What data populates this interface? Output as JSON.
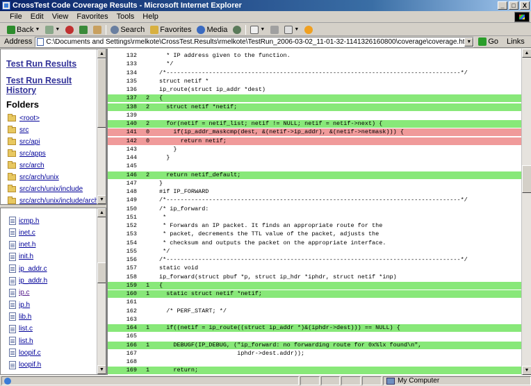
{
  "window": {
    "title": "CrossTest Code Coverage Results - Microsoft Internet Explorer",
    "controls": [
      "_",
      "□",
      "X"
    ]
  },
  "menu": [
    "File",
    "Edit",
    "View",
    "Favorites",
    "Tools",
    "Help"
  ],
  "toolbar": {
    "back": "Back",
    "search": "Search",
    "favorites": "Favorites",
    "media": "Media"
  },
  "address": {
    "label": "Address",
    "value": "C:\\Documents and Settings\\rmelkote\\CrossTest.Results\\rmelkote\\TestRun_2006-03-02_11-01-32-1141326160800\\coverage\\coverage.html",
    "go": "Go",
    "links": "Links"
  },
  "nav": {
    "test_run_results": "Test Run Results",
    "test_run_result_history": [
      "Test Run Result",
      "History"
    ],
    "folders_heading": "Folders",
    "folders": [
      "<root>",
      "src",
      "src/api",
      "src/apps",
      "src/arch",
      "src/arch/unix",
      "src/arch/unix/include",
      "src/arch/unix/include/arch"
    ],
    "files": [
      "icmp.h",
      "inet.c",
      "inet.h",
      "init.h",
      "ip_addr.c",
      "ip_addr.h",
      "ip.c",
      "ip.h",
      "lib.h",
      "list.c",
      "list.h",
      "loopif.c",
      "loopif.h"
    ]
  },
  "status": {
    "zone": "My Computer"
  },
  "code": [
    {
      "n": "132",
      "c": "",
      "s": "  * IP address given to the function.",
      "h": ""
    },
    {
      "n": "133",
      "c": "",
      "s": "  */",
      "h": ""
    },
    {
      "n": "134",
      "c": "",
      "s": "/*-----------------------------------------------------------------------------------*/",
      "h": ""
    },
    {
      "n": "135",
      "c": "",
      "s": "struct netif *",
      "h": ""
    },
    {
      "n": "136",
      "c": "",
      "s": "ip_route(struct ip_addr *dest)",
      "h": ""
    },
    {
      "n": "137",
      "c": "2",
      "s": "{",
      "h": "g"
    },
    {
      "n": "138",
      "c": "2",
      "s": "  struct netif *netif;",
      "h": "g"
    },
    {
      "n": "139",
      "c": "",
      "s": "",
      "h": ""
    },
    {
      "n": "140",
      "c": "2",
      "s": "  for(netif = netif_list; netif != NULL; netif = netif->next) {",
      "h": "g"
    },
    {
      "n": "141",
      "c": "0",
      "s": "    if(ip_addr_maskcmp(dest, &(netif->ip_addr), &(netif->netmask))) {",
      "h": "r"
    },
    {
      "n": "142",
      "c": "0",
      "s": "      return netif;",
      "h": "r"
    },
    {
      "n": "143",
      "c": "",
      "s": "    }",
      "h": ""
    },
    {
      "n": "144",
      "c": "",
      "s": "  }",
      "h": ""
    },
    {
      "n": "145",
      "c": "",
      "s": "",
      "h": ""
    },
    {
      "n": "146",
      "c": "2",
      "s": "  return netif_default;",
      "h": "g"
    },
    {
      "n": "147",
      "c": "",
      "s": "}",
      "h": ""
    },
    {
      "n": "148",
      "c": "",
      "s": "#if IP_FORWARD",
      "h": ""
    },
    {
      "n": "149",
      "c": "",
      "s": "/*-----------------------------------------------------------------------------------*/",
      "h": ""
    },
    {
      "n": "150",
      "c": "",
      "s": "/* ip_forward:",
      "h": ""
    },
    {
      "n": "151",
      "c": "",
      "s": " *",
      "h": ""
    },
    {
      "n": "152",
      "c": "",
      "s": " * Forwards an IP packet. It finds an appropriate route for the",
      "h": ""
    },
    {
      "n": "153",
      "c": "",
      "s": " * packet, decrements the TTL value of the packet, adjusts the",
      "h": ""
    },
    {
      "n": "154",
      "c": "",
      "s": " * checksum and outputs the packet on the appropriate interface.",
      "h": ""
    },
    {
      "n": "155",
      "c": "",
      "s": " */",
      "h": ""
    },
    {
      "n": "156",
      "c": "",
      "s": "/*-----------------------------------------------------------------------------------*/",
      "h": ""
    },
    {
      "n": "157",
      "c": "",
      "s": "static void",
      "h": ""
    },
    {
      "n": "158",
      "c": "",
      "s": "ip_forward(struct pbuf *p, struct ip_hdr *iphdr, struct netif *inp)",
      "h": ""
    },
    {
      "n": "159",
      "c": "1",
      "s": "{",
      "h": "g"
    },
    {
      "n": "160",
      "c": "1",
      "s": "  static struct netif *netif;",
      "h": "g"
    },
    {
      "n": "161",
      "c": "",
      "s": "",
      "h": ""
    },
    {
      "n": "162",
      "c": "",
      "s": "  /* PERF_START; */",
      "h": ""
    },
    {
      "n": "163",
      "c": "",
      "s": "",
      "h": ""
    },
    {
      "n": "164",
      "c": "1",
      "s": "  if((netif = ip_route((struct ip_addr *)&(iphdr->dest))) == NULL) {",
      "h": "g"
    },
    {
      "n": "165",
      "c": "",
      "s": "",
      "h": ""
    },
    {
      "n": "166",
      "c": "1",
      "s": "    DEBUGF(IP_DEBUG, (\"ip_forward: no forwarding route for 0x%lx found\\n\",",
      "h": "g"
    },
    {
      "n": "167",
      "c": "",
      "s": "                      iphdr->dest.addr));",
      "h": ""
    },
    {
      "n": "168",
      "c": "",
      "s": "",
      "h": ""
    },
    {
      "n": "169",
      "c": "1",
      "s": "    return;",
      "h": "g"
    }
  ]
}
